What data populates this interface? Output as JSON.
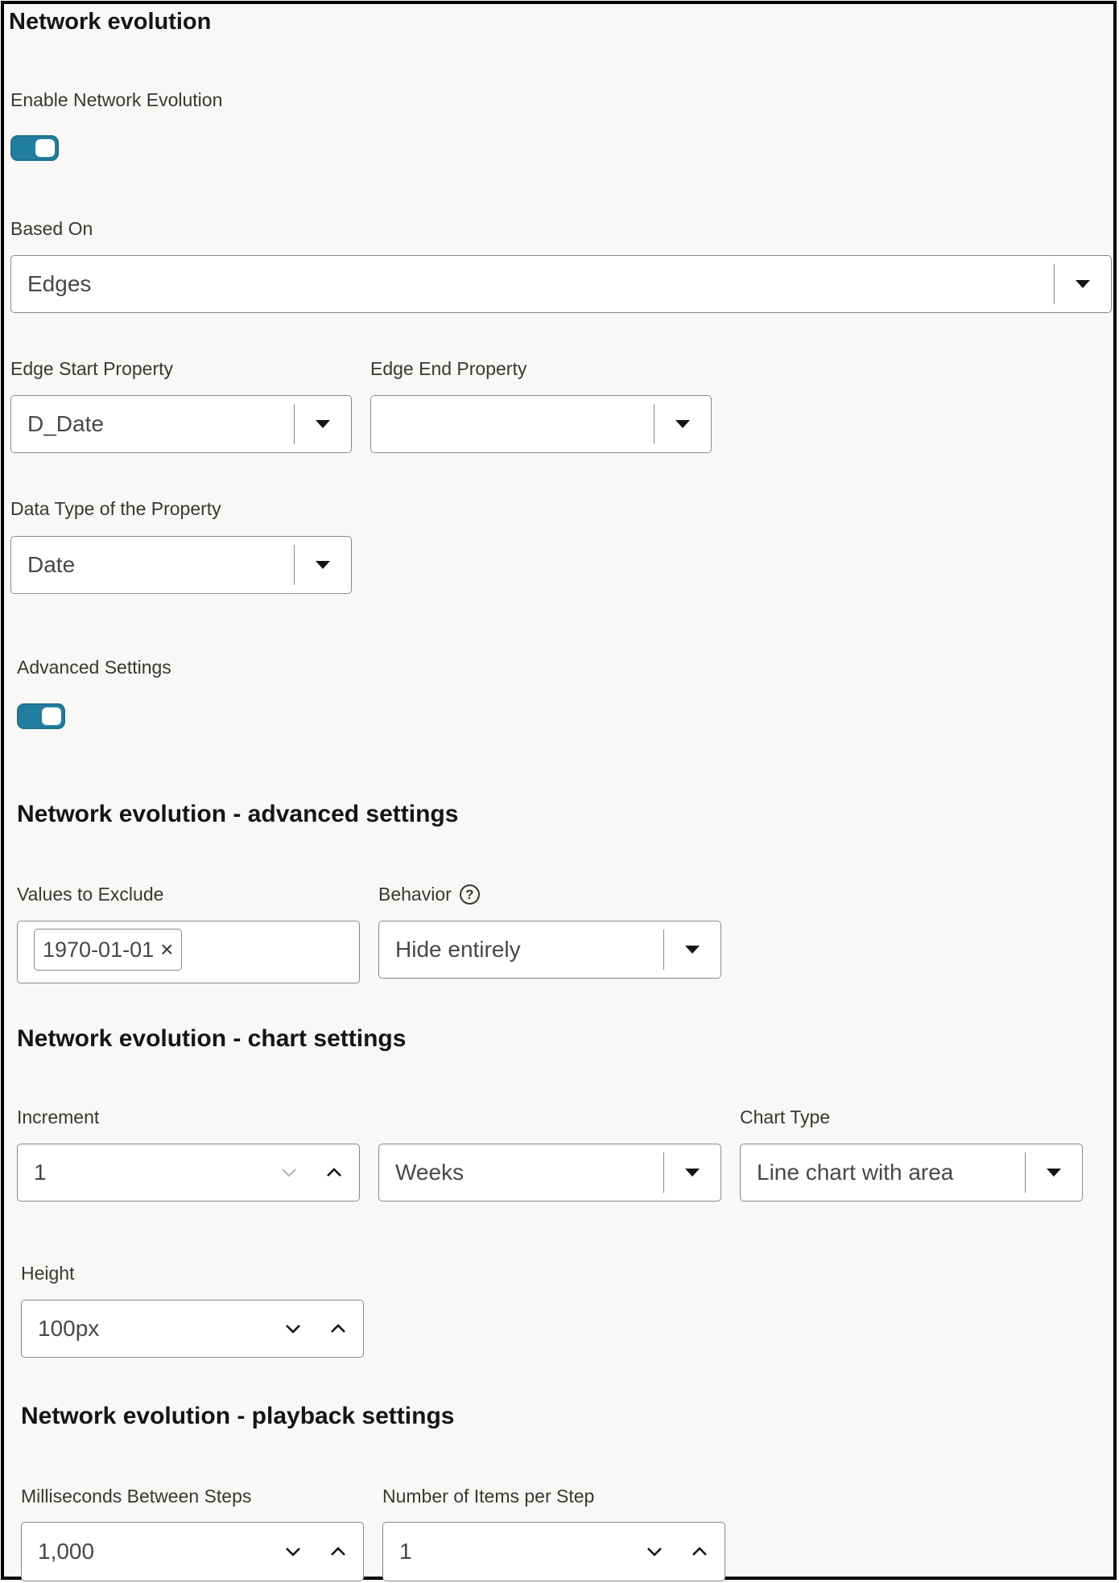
{
  "section_main": {
    "title": "Network evolution",
    "enable_label": "Enable Network Evolution",
    "enable_on": true,
    "based_on": {
      "label": "Based On",
      "value": "Edges"
    },
    "edge_start": {
      "label": "Edge Start Property",
      "value": "D_Date"
    },
    "edge_end": {
      "label": "Edge End Property",
      "value": ""
    },
    "data_type": {
      "label": "Data Type of the Property",
      "value": "Date"
    },
    "advanced_label": "Advanced Settings",
    "advanced_on": true
  },
  "section_advanced": {
    "title": "Network evolution - advanced settings",
    "exclude": {
      "label": "Values to Exclude",
      "chip": "1970-01-01",
      "chip_remove": "×"
    },
    "behavior": {
      "label": "Behavior",
      "help": "?",
      "value": "Hide entirely"
    }
  },
  "section_chart": {
    "title": "Network evolution - chart settings",
    "increment": {
      "label": "Increment",
      "value": "1",
      "unit": "Weeks"
    },
    "chart_type": {
      "label": "Chart Type",
      "value": "Line chart with area"
    },
    "height": {
      "label": "Height",
      "value": "100px"
    }
  },
  "section_playback": {
    "title": "Network evolution - playback settings",
    "ms_between": {
      "label": "Milliseconds Between Steps",
      "value": "1,000"
    },
    "items_per_step": {
      "label": "Number of Items per Step",
      "value": "1"
    }
  },
  "colors": {
    "toggle_on": "#227e9e",
    "background": "#f9f8f6",
    "border": "#8b8884"
  }
}
